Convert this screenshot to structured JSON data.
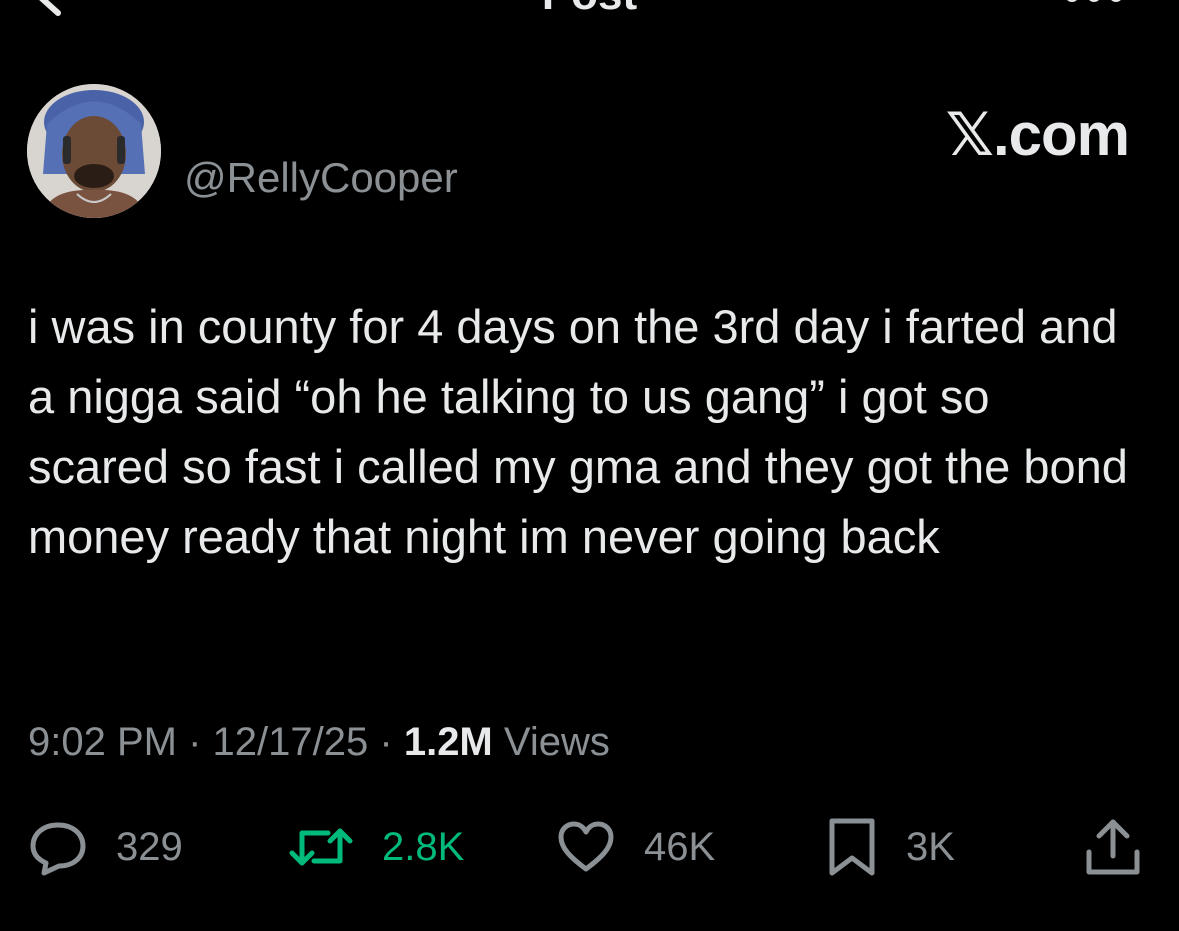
{
  "header": {
    "title": "Post"
  },
  "author": {
    "handle": "@RellyCooper"
  },
  "brand": "𝕏.com",
  "post": {
    "text": "i was in county for 4 days on the 3rd day i farted and a nigga said “oh he talking to us gang” i got so scared so fast i called my gma and they got the bond money ready that night im never going back"
  },
  "meta": {
    "time": "9:02 PM",
    "separator": "·",
    "date": "12/17/25",
    "views_count": "1.2M",
    "views_label": "Views"
  },
  "actions": {
    "replies": "329",
    "reposts": "2.8K",
    "likes": "46K",
    "bookmarks": "3K"
  },
  "colors": {
    "background": "#000000",
    "text": "#e7e9ea",
    "muted": "#8b9095",
    "repost_active": "#00ba7c"
  }
}
